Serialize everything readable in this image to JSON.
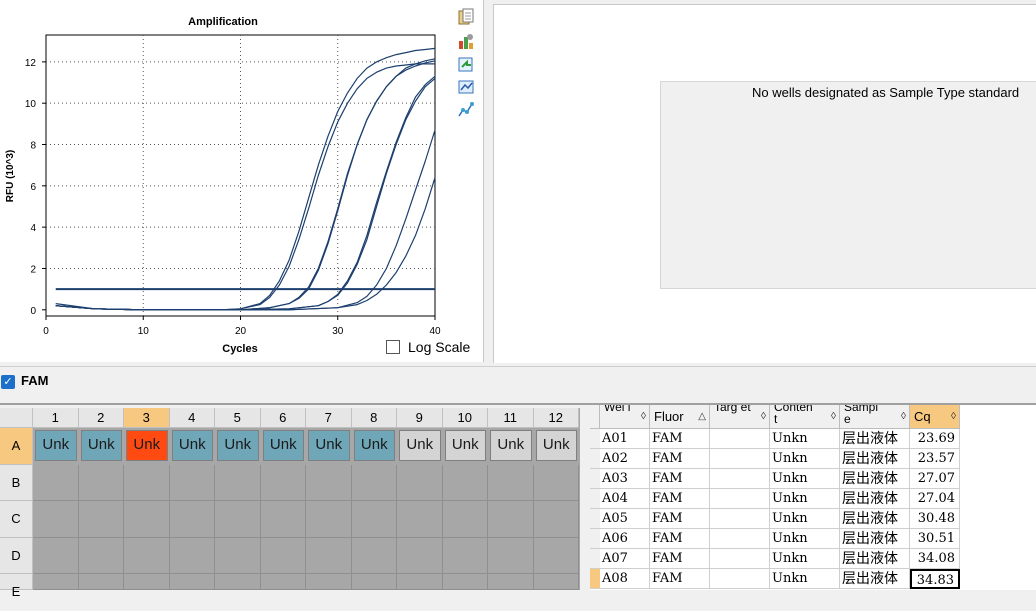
{
  "chart": {
    "title": "Amplification",
    "xlabel": "Cycles",
    "ylabel": "RFU (10^3)",
    "log_scale_label": "Log Scale"
  },
  "chart_data": {
    "type": "line",
    "title": "Amplification",
    "xlabel": "Cycles",
    "ylabel": "RFU (10^3)",
    "xlim": [
      0,
      40
    ],
    "ylim": [
      -0.3,
      13.3
    ],
    "xticks": [
      0,
      10,
      20,
      30,
      40
    ],
    "yticks": [
      0,
      2,
      4,
      6,
      8,
      10,
      12
    ],
    "grid": true,
    "threshold": 1.0,
    "series": [
      {
        "values_x": [
          1,
          5,
          10,
          15,
          18,
          20,
          22,
          23,
          24,
          25,
          26,
          27,
          28,
          29,
          30,
          31,
          32,
          33,
          34,
          35,
          36,
          37,
          38,
          39,
          40
        ],
        "values_y": [
          0.3,
          0.05,
          0,
          0,
          0,
          0.05,
          0.3,
          0.7,
          1.4,
          2.4,
          3.8,
          5.4,
          7.0,
          8.4,
          9.6,
          10.5,
          11.2,
          11.7,
          12.0,
          12.2,
          12.35,
          12.45,
          12.55,
          12.6,
          12.65
        ]
      },
      {
        "values_x": [
          1,
          5,
          10,
          15,
          18,
          20,
          22,
          23,
          24,
          25,
          26,
          27,
          28,
          29,
          30,
          31,
          32,
          33,
          34,
          35,
          36,
          37,
          38,
          39,
          40
        ],
        "values_y": [
          0.2,
          0.05,
          0,
          0,
          0,
          0.05,
          0.25,
          0.6,
          1.2,
          2.1,
          3.4,
          4.9,
          6.5,
          7.9,
          9.1,
          10.0,
          10.7,
          11.2,
          11.5,
          11.7,
          11.8,
          11.85,
          11.9,
          11.9,
          11.9
        ]
      },
      {
        "values_x": [
          1,
          5,
          10,
          15,
          20,
          23,
          25,
          26,
          27,
          28,
          29,
          30,
          31,
          32,
          33,
          34,
          35,
          36,
          37,
          38,
          39,
          40
        ],
        "values_y": [
          0.2,
          0.05,
          0,
          0,
          0,
          0.1,
          0.3,
          0.6,
          1.1,
          2.0,
          3.3,
          4.9,
          6.6,
          8.0,
          9.2,
          10.1,
          10.8,
          11.3,
          11.7,
          11.9,
          12.05,
          12.15
        ]
      },
      {
        "values_x": [
          1,
          5,
          10,
          15,
          20,
          23,
          25,
          26,
          27,
          28,
          29,
          30,
          31,
          32,
          33,
          34,
          35,
          36,
          37,
          38,
          39,
          40
        ],
        "values_y": [
          0.2,
          0.05,
          0,
          0,
          0,
          0.1,
          0.3,
          0.55,
          1.0,
          1.9,
          3.2,
          4.8,
          6.5,
          8.0,
          9.2,
          10.1,
          10.8,
          11.3,
          11.6,
          11.8,
          11.95,
          12.05
        ]
      },
      {
        "values_x": [
          1,
          5,
          10,
          15,
          20,
          25,
          28,
          29,
          30,
          31,
          32,
          33,
          34,
          35,
          36,
          37,
          38,
          39,
          40
        ],
        "values_y": [
          0.2,
          0.05,
          0,
          0,
          0,
          0.05,
          0.2,
          0.4,
          0.75,
          1.4,
          2.3,
          3.6,
          5.2,
          6.7,
          8.1,
          9.3,
          10.3,
          10.9,
          11.3
        ]
      },
      {
        "values_x": [
          1,
          5,
          10,
          15,
          20,
          25,
          28,
          29,
          30,
          31,
          32,
          33,
          34,
          35,
          36,
          37,
          38,
          39,
          40
        ],
        "values_y": [
          0.2,
          0.05,
          0,
          0,
          0,
          0.05,
          0.2,
          0.4,
          0.7,
          1.3,
          2.2,
          3.4,
          5.0,
          6.6,
          8.0,
          9.2,
          10.1,
          10.8,
          11.2
        ]
      },
      {
        "values_x": [
          1,
          5,
          10,
          15,
          20,
          25,
          30,
          32,
          33,
          34,
          35,
          36,
          37,
          38,
          39,
          40
        ],
        "values_y": [
          0.2,
          0.05,
          0,
          0,
          0,
          0,
          0.1,
          0.35,
          0.65,
          1.2,
          2.0,
          3.1,
          4.4,
          5.8,
          7.2,
          8.7
        ]
      },
      {
        "values_x": [
          1,
          5,
          10,
          15,
          20,
          25,
          30,
          32,
          33,
          34,
          35,
          36,
          37,
          38,
          39,
          40
        ],
        "values_y": [
          0.2,
          0.05,
          0,
          0,
          0,
          0,
          0.1,
          0.25,
          0.45,
          0.75,
          1.2,
          1.8,
          2.6,
          3.6,
          4.9,
          6.4
        ]
      }
    ]
  },
  "right_panel": {
    "message": "No wells designated as Sample Type standard"
  },
  "fluor_filter": {
    "label": "FAM",
    "checked": true
  },
  "plate": {
    "columns": [
      "1",
      "2",
      "3",
      "4",
      "5",
      "6",
      "7",
      "8",
      "9",
      "10",
      "11",
      "12"
    ],
    "rows": [
      "A",
      "B",
      "C",
      "D",
      "E"
    ],
    "row_a_wells": [
      "Unk",
      "Unk",
      "Unk",
      "Unk",
      "Unk",
      "Unk",
      "Unk",
      "Unk",
      "Unk",
      "Unk",
      "Unk",
      "Unk"
    ],
    "selected_column": "3",
    "selected_row": "A"
  },
  "table": {
    "headers": [
      "Wel l",
      "Fluor",
      "Targ et",
      "Conten t",
      "Sampl e",
      "Cq"
    ],
    "rows": [
      {
        "well": "A01",
        "fluor": "FAM",
        "target": "",
        "content": "Unkn",
        "sample": "层出液体",
        "cq": "23.69"
      },
      {
        "well": "A02",
        "fluor": "FAM",
        "target": "",
        "content": "Unkn",
        "sample": "层出液体",
        "cq": "23.57"
      },
      {
        "well": "A03",
        "fluor": "FAM",
        "target": "",
        "content": "Unkn",
        "sample": "层出液体",
        "cq": "27.07"
      },
      {
        "well": "A04",
        "fluor": "FAM",
        "target": "",
        "content": "Unkn",
        "sample": "层出液体",
        "cq": "27.04"
      },
      {
        "well": "A05",
        "fluor": "FAM",
        "target": "",
        "content": "Unkn",
        "sample": "层出液体",
        "cq": "30.48"
      },
      {
        "well": "A06",
        "fluor": "FAM",
        "target": "",
        "content": "Unkn",
        "sample": "层出液体",
        "cq": "30.51"
      },
      {
        "well": "A07",
        "fluor": "FAM",
        "target": "",
        "content": "Unkn",
        "sample": "层出液体",
        "cq": "34.08"
      },
      {
        "well": "A08",
        "fluor": "FAM",
        "target": "",
        "content": "Unkn",
        "sample": "层出液体",
        "cq": "34.83"
      }
    ]
  },
  "colors": {
    "curve": "#1c3f6e",
    "well_teal": "#6fa6b8",
    "well_selected": "#ff4a12",
    "well_gray": "#d4d4d4",
    "selected_header": "#f7c87f"
  }
}
